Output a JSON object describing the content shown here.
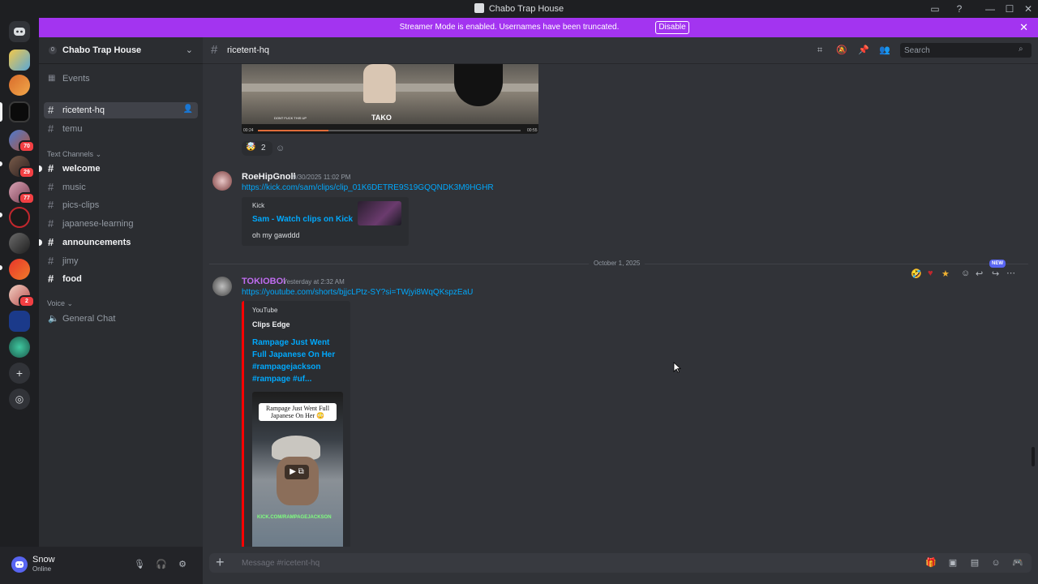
{
  "window": {
    "title": "Chabo Trap House",
    "controls": [
      "—",
      "☐",
      "✕"
    ]
  },
  "banner": {
    "text": "Streamer Mode is enabled. Usernames have been truncated.",
    "button": "Disable"
  },
  "guilds": {
    "badges": [
      "70",
      "29",
      "77",
      "2"
    ]
  },
  "server": {
    "name": "Chabo Trap House"
  },
  "sidebar": {
    "events": "Events",
    "pinned_channels": [
      {
        "name": "ricetent-hq",
        "state": "active"
      },
      {
        "name": "temu",
        "state": "read"
      }
    ],
    "text_category": "Text Channels",
    "text_channels": [
      {
        "name": "welcome",
        "state": "unread"
      },
      {
        "name": "music",
        "state": "read"
      },
      {
        "name": "pics-clips",
        "state": "read"
      },
      {
        "name": "japanese-learning",
        "state": "read"
      },
      {
        "name": "announcements",
        "state": "unread"
      },
      {
        "name": "jimy",
        "state": "read"
      },
      {
        "name": "food",
        "state": "unread"
      }
    ],
    "voice_category": "Voice",
    "voice_channels": [
      {
        "name": "General Chat"
      }
    ]
  },
  "user": {
    "name": "Snow",
    "status": "Online"
  },
  "chat": {
    "channel": "ricetent-hq",
    "search_placeholder": "Search",
    "composer_placeholder": "Message #ricetent-hq"
  },
  "messages": {
    "video_top": {
      "caption": "DONT FUCK THIS UP",
      "watermark": "TAKO",
      "time_start": "00:24",
      "time_end": "00:55",
      "progress": 0.27,
      "reaction_count": "2"
    },
    "msg1": {
      "author": "RoeHipGnoll",
      "time": "9/30/2025 11:02 PM",
      "link": "https://kick.com/sam/clips/clip_01K6DETRE9S19GQQNDK3M9HGHR",
      "embed_provider": "Kick",
      "embed_title": "Sam - Watch clips on Kick",
      "embed_desc": "oh my gawddd"
    },
    "divider": "October 1, 2025",
    "new_badge": "NEW",
    "msg2": {
      "author": "TOKIOBOI",
      "time": "Yesterday at 2:32 AM",
      "link": "https://youtube.com/shorts/bjjcLPtz-SY?si=TWjyi8WqQKspzEaU",
      "embed_provider": "YouTube",
      "embed_author": "Clips Edge",
      "embed_title_lines": [
        "Rampage Just Went",
        "Full Japanese On Her",
        "#rampagejackson",
        "#rampage #uf..."
      ],
      "thumb_caption": "Rampage Just Went Full Japanese On Her 😳",
      "thumb_footer": "KICK.COM/RAMPAGEJACKSON"
    }
  },
  "colors": {
    "banner": "#a334f0",
    "link": "#00a8fc",
    "youtube_bar": "#ff0000",
    "author2": "#c06cf0",
    "badge": "#f23f43",
    "new_badge": "#5865f2"
  }
}
